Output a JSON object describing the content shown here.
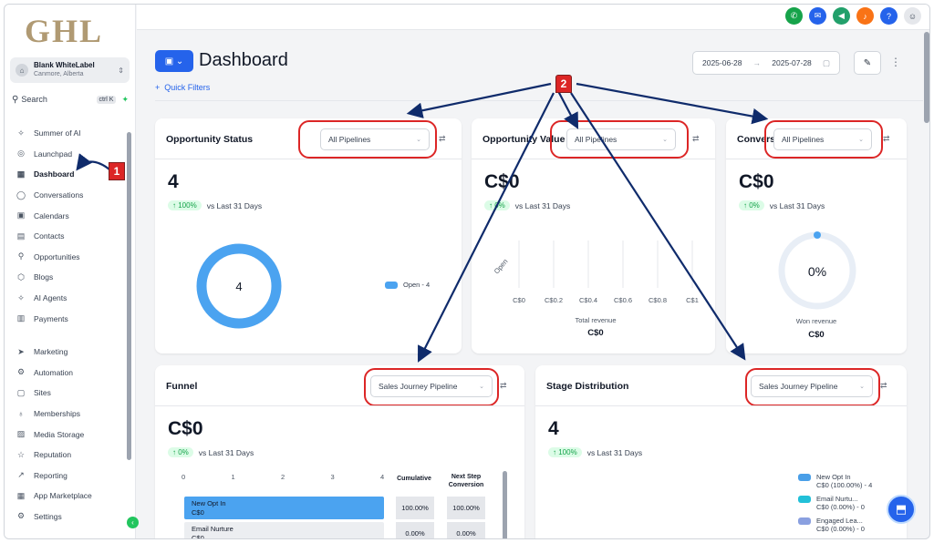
{
  "brand": {
    "logo_text": "GHL"
  },
  "account": {
    "name": "Blank WhiteLabel",
    "location": "Canmore, Alberta"
  },
  "search": {
    "label": "Search",
    "shortcut": "ctrl K"
  },
  "sidebar": {
    "items": [
      {
        "label": "Summer of AI",
        "icon": "sparkle-icon"
      },
      {
        "label": "Launchpad",
        "icon": "rocket-icon"
      },
      {
        "label": "Dashboard",
        "icon": "grid-icon"
      },
      {
        "label": "Conversations",
        "icon": "chat-icon"
      },
      {
        "label": "Calendars",
        "icon": "calendar-icon"
      },
      {
        "label": "Contacts",
        "icon": "contacts-icon"
      },
      {
        "label": "Opportunities",
        "icon": "filter-icon"
      },
      {
        "label": "Blogs",
        "icon": "cube-icon"
      },
      {
        "label": "AI Agents",
        "icon": "sparkle-icon"
      },
      {
        "label": "Payments",
        "icon": "receipt-icon"
      }
    ],
    "items2": [
      {
        "label": "Marketing",
        "icon": "send-icon"
      },
      {
        "label": "Automation",
        "icon": "automation-icon"
      },
      {
        "label": "Sites",
        "icon": "sites-icon"
      },
      {
        "label": "Memberships",
        "icon": "membership-icon"
      },
      {
        "label": "Media Storage",
        "icon": "image-icon"
      },
      {
        "label": "Reputation",
        "icon": "star-icon"
      },
      {
        "label": "Reporting",
        "icon": "chart-icon"
      },
      {
        "label": "App Marketplace",
        "icon": "apps-icon"
      },
      {
        "label": "Settings",
        "icon": "gear-icon"
      }
    ]
  },
  "header": {
    "title": "Dashboard",
    "quick_filters": "Quick Filters",
    "date_start": "2025-06-28",
    "date_end": "2025-07-28"
  },
  "cards": {
    "opportunity_status": {
      "title": "Opportunity Status",
      "pipeline": "All Pipelines",
      "value": "4",
      "change": "↑ 100%",
      "compare": "vs Last 31 Days",
      "donut_label": "4",
      "legend": "Open - 4"
    },
    "opportunity_value": {
      "title": "Opportunity Value",
      "pipeline": "All Pipelines",
      "value": "C$0",
      "change": "↑ 0%",
      "compare": "vs Last 31 Days",
      "y_label": "Open",
      "x_ticks": [
        "C$0",
        "C$0.2",
        "C$0.4",
        "C$0.6",
        "C$0.8",
        "C$1"
      ],
      "x_title": "Total revenue",
      "total": "C$0"
    },
    "conversion": {
      "title": "Conversion",
      "pipeline": "All Pipelines",
      "value": "C$0",
      "change": "↑ 0%",
      "compare": "vs Last 31 Days",
      "gauge_label": "0%",
      "gauge_fraction": 0,
      "caption": "Won revenue",
      "total": "C$0"
    },
    "funnel": {
      "title": "Funnel",
      "pipeline": "Sales Journey Pipeline",
      "value": "C$0",
      "change": "↑ 0%",
      "compare": "vs Last 31 Days",
      "axis": [
        "0",
        "1",
        "2",
        "3",
        "4"
      ],
      "col_cumulative": "Cumulative",
      "col_next_step": "Next Step Conversion",
      "rows": [
        {
          "name": "New Opt In",
          "value": "C$0",
          "cumulative": "100.00%",
          "next": "100.00%",
          "count": 4
        },
        {
          "name": "Email Nurture",
          "value": "C$0",
          "cumulative": "0.00%",
          "next": "0.00%",
          "count": 0
        }
      ]
    },
    "stage_distribution": {
      "title": "Stage Distribution",
      "pipeline": "Sales Journey Pipeline",
      "value": "4",
      "change": "↑ 100%",
      "compare": "vs Last 31 Days",
      "legend": [
        {
          "name": "New Opt In",
          "detail": "C$0 (100.00%) - 4",
          "color": "#4a9fe8"
        },
        {
          "name": "Email Nurtu...",
          "detail": "C$0 (0.00%) - 0",
          "color": "#22c0d8"
        },
        {
          "name": "Engaged Lea...",
          "detail": "C$0 (0.00%) - 0",
          "color": "#8aa0e0"
        }
      ]
    }
  },
  "annotations": {
    "badge1": "1",
    "badge2": "2"
  },
  "colors": {
    "primary": "#2563eb",
    "donut": "#4ba3f0",
    "annotation_red": "#dc2626",
    "arrow_navy": "#0f2b6b"
  }
}
